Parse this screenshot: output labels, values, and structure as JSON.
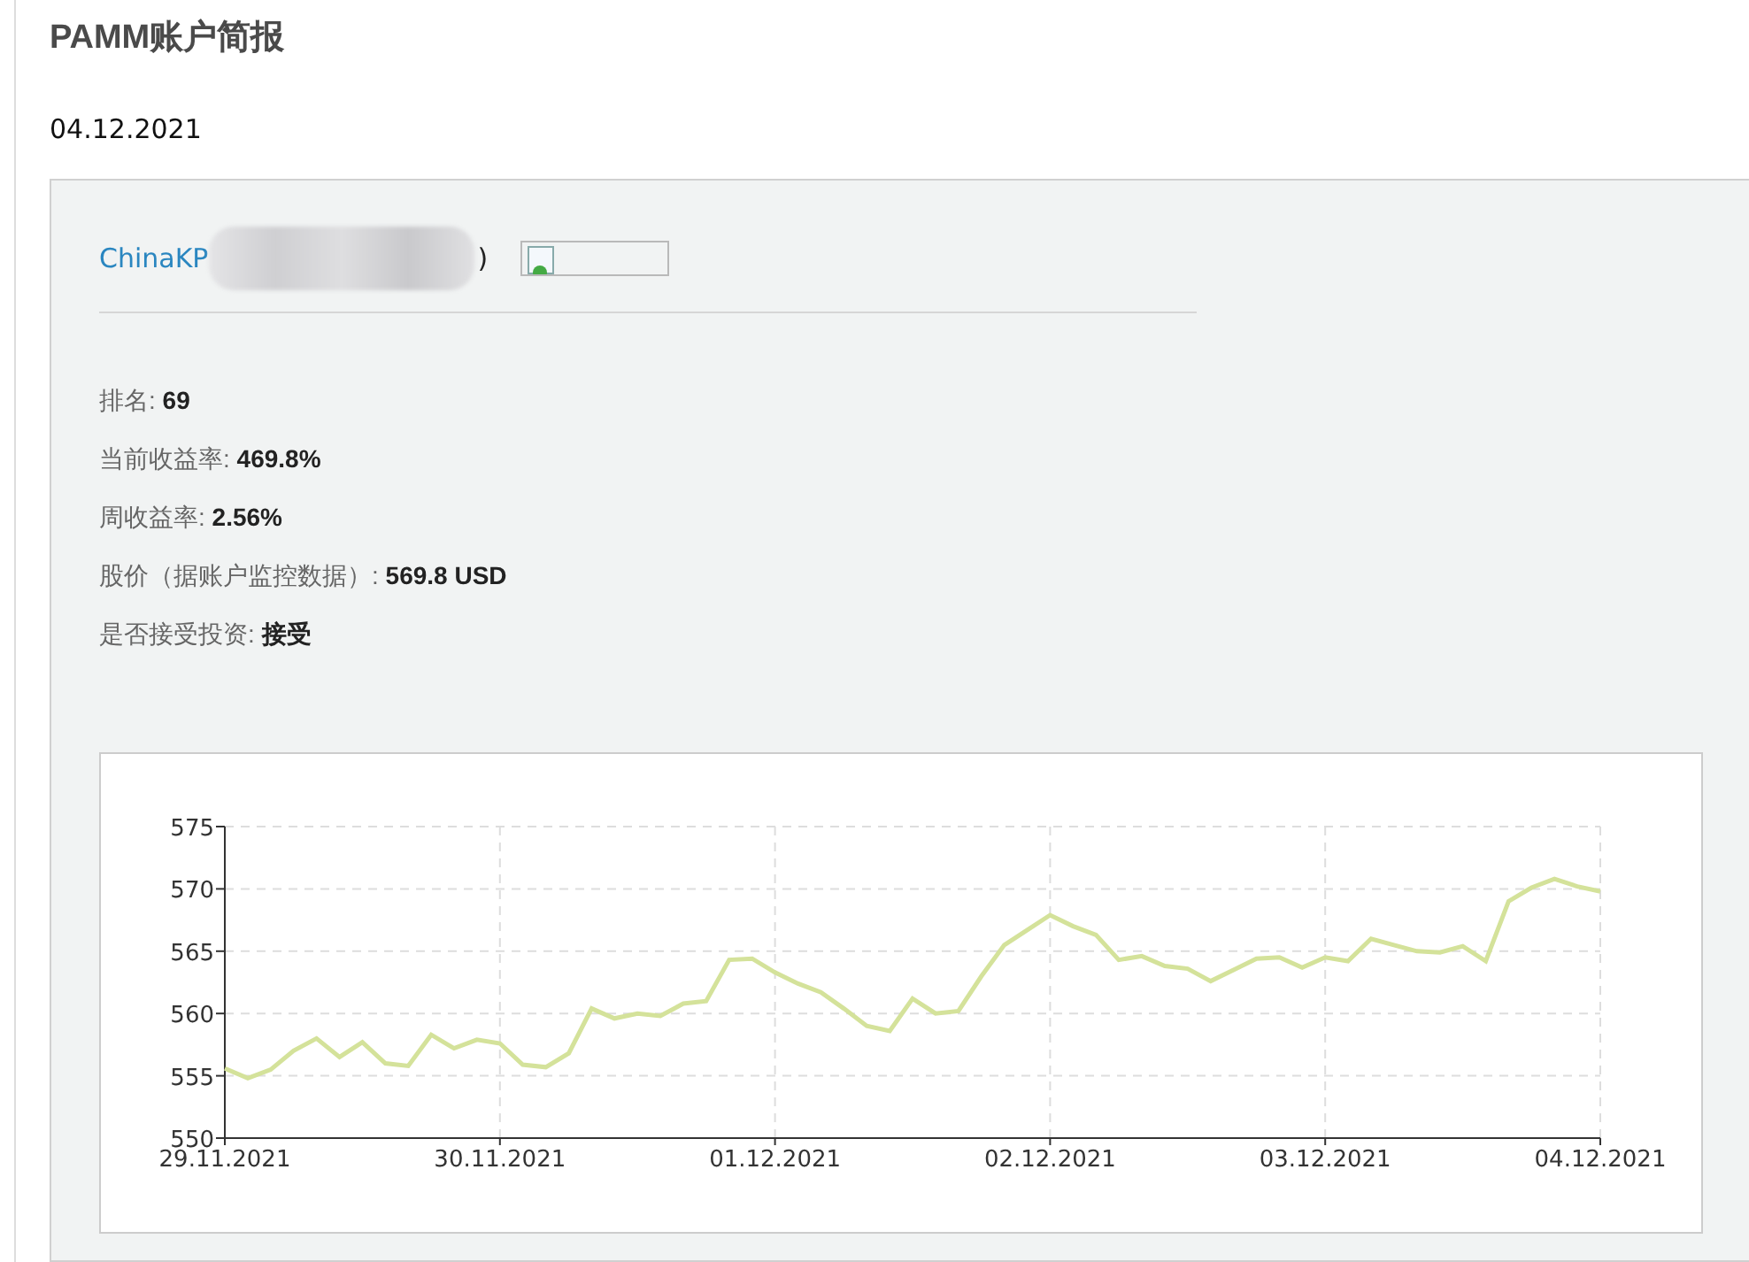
{
  "title": "PAMM账户简报",
  "date": "04.12.2021",
  "account": {
    "name": "ChinaKP",
    "suffix": ")"
  },
  "stats": [
    {
      "label": "排名: ",
      "value": "69"
    },
    {
      "label": "当前收益率: ",
      "value": "469.8%"
    },
    {
      "label": "周收益率: ",
      "value": "2.56%"
    },
    {
      "label": "股价（据账户监控数据）: ",
      "value": "569.8 USD"
    },
    {
      "label": "是否接受投资: ",
      "value": "接受"
    }
  ],
  "chart": {
    "chart_data": {
      "type": "line",
      "categories": [
        "29.11.2021",
        null,
        null,
        null,
        null,
        null,
        null,
        null,
        null,
        null,
        null,
        null,
        "30.11.2021",
        null,
        null,
        null,
        null,
        null,
        null,
        null,
        null,
        null,
        null,
        null,
        "01.12.2021",
        null,
        null,
        null,
        null,
        null,
        null,
        null,
        null,
        null,
        null,
        null,
        "02.12.2021",
        null,
        null,
        null,
        null,
        null,
        null,
        null,
        null,
        null,
        null,
        null,
        "03.12.2021",
        null,
        null,
        null,
        null,
        null,
        null,
        null,
        null,
        null,
        null,
        null,
        "04.12.2021"
      ],
      "series": [
        {
          "color": "#d4e29a",
          "values": [
            555.6,
            554.8,
            555.5,
            557,
            558,
            556.5,
            557.7,
            556,
            555.8,
            558.3,
            557.2,
            557.9,
            557.6,
            555.9,
            555.7,
            556.8,
            560.4,
            559.6,
            560,
            559.8,
            560.8,
            561,
            564.3,
            564.4,
            563.3,
            562.4,
            561.7,
            560.4,
            559,
            558.6,
            561.2,
            560,
            560.2,
            563,
            565.5,
            566.7,
            567.9,
            567,
            566.3,
            564.3,
            564.6,
            563.8,
            563.6,
            562.6,
            563.5,
            564.4,
            564.5,
            563.7,
            564.5,
            564.2,
            566,
            565.5,
            565,
            564.9,
            565.4,
            564.2,
            569,
            570.1,
            570.8,
            570.2,
            569.8
          ]
        }
      ],
      "ylim": [
        550,
        575
      ],
      "grid": true,
      "yticks": [
        550,
        555,
        560,
        565,
        570,
        575
      ]
    }
  }
}
